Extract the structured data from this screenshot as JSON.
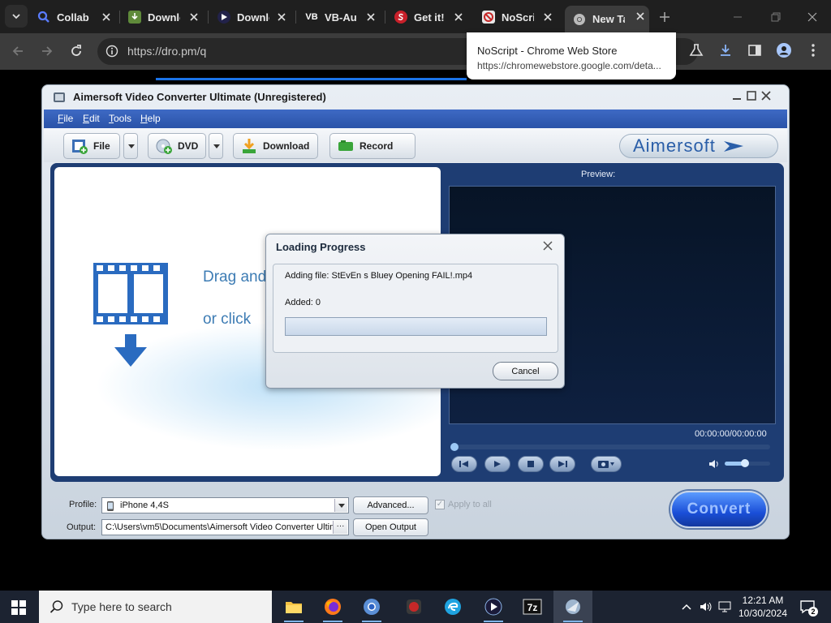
{
  "browser": {
    "tabs": [
      {
        "title": "Collab",
        "favicon": "search-favicon"
      },
      {
        "title": "Downlo",
        "favicon": "download-favicon"
      },
      {
        "title": "Downlo",
        "favicon": "play-favicon"
      },
      {
        "title": "VB-Au",
        "favicon": "vb-favicon",
        "favicon_text": "VB"
      },
      {
        "title": "Get it!",
        "favicon": "red-s-favicon"
      },
      {
        "title": "NoScri",
        "favicon": "noscript-favicon"
      },
      {
        "title": "New Ta",
        "favicon": "chrome-favicon",
        "active": true
      }
    ],
    "url": "https://dro.pm/q",
    "tooltip": {
      "title": "NoScript - Chrome Web Store",
      "url": "https://chromewebstore.google.com/deta..."
    }
  },
  "app": {
    "title": "Aimersoft Video Converter Ultimate (Unregistered)",
    "menu": [
      "File",
      "Edit",
      "Tools",
      "Help"
    ],
    "toolbar": {
      "file": "File",
      "dvd": "DVD",
      "download": "Download",
      "record": "Record"
    },
    "brand": "Aimersoft",
    "drop_line1": "Drag and",
    "drop_line2": "or click",
    "preview_label": "Preview:",
    "timecode": "00:00:00/00:00:00",
    "volume_level": 0.45,
    "bottom": {
      "profile_label": "Profile:",
      "profile_value": "iPhone 4,4S",
      "advanced": "Advanced...",
      "apply_all": "Apply to all",
      "output_label": "Output:",
      "output_value": "C:\\Users\\vm5\\Documents\\Aimersoft Video Converter Ultim",
      "output_browse": "···",
      "open_output": "Open Output",
      "convert": "Convert"
    }
  },
  "dialog": {
    "title": "Loading Progress",
    "adding_file": "Adding file: StEvEn s Bluey Opening FAIL!.mp4",
    "added": "Added: 0",
    "progress": 0,
    "cancel": "Cancel"
  },
  "taskbar": {
    "search_placeholder": "Type here to search",
    "time": "12:21 AM",
    "date": "10/30/2024",
    "notification_count": "2"
  },
  "colors": {
    "chrome_bg": "#1f1f1f",
    "menu_blue": "#2a53a8",
    "convert_blue": "#1a4fd8",
    "drop_text": "#3d7cb4"
  }
}
